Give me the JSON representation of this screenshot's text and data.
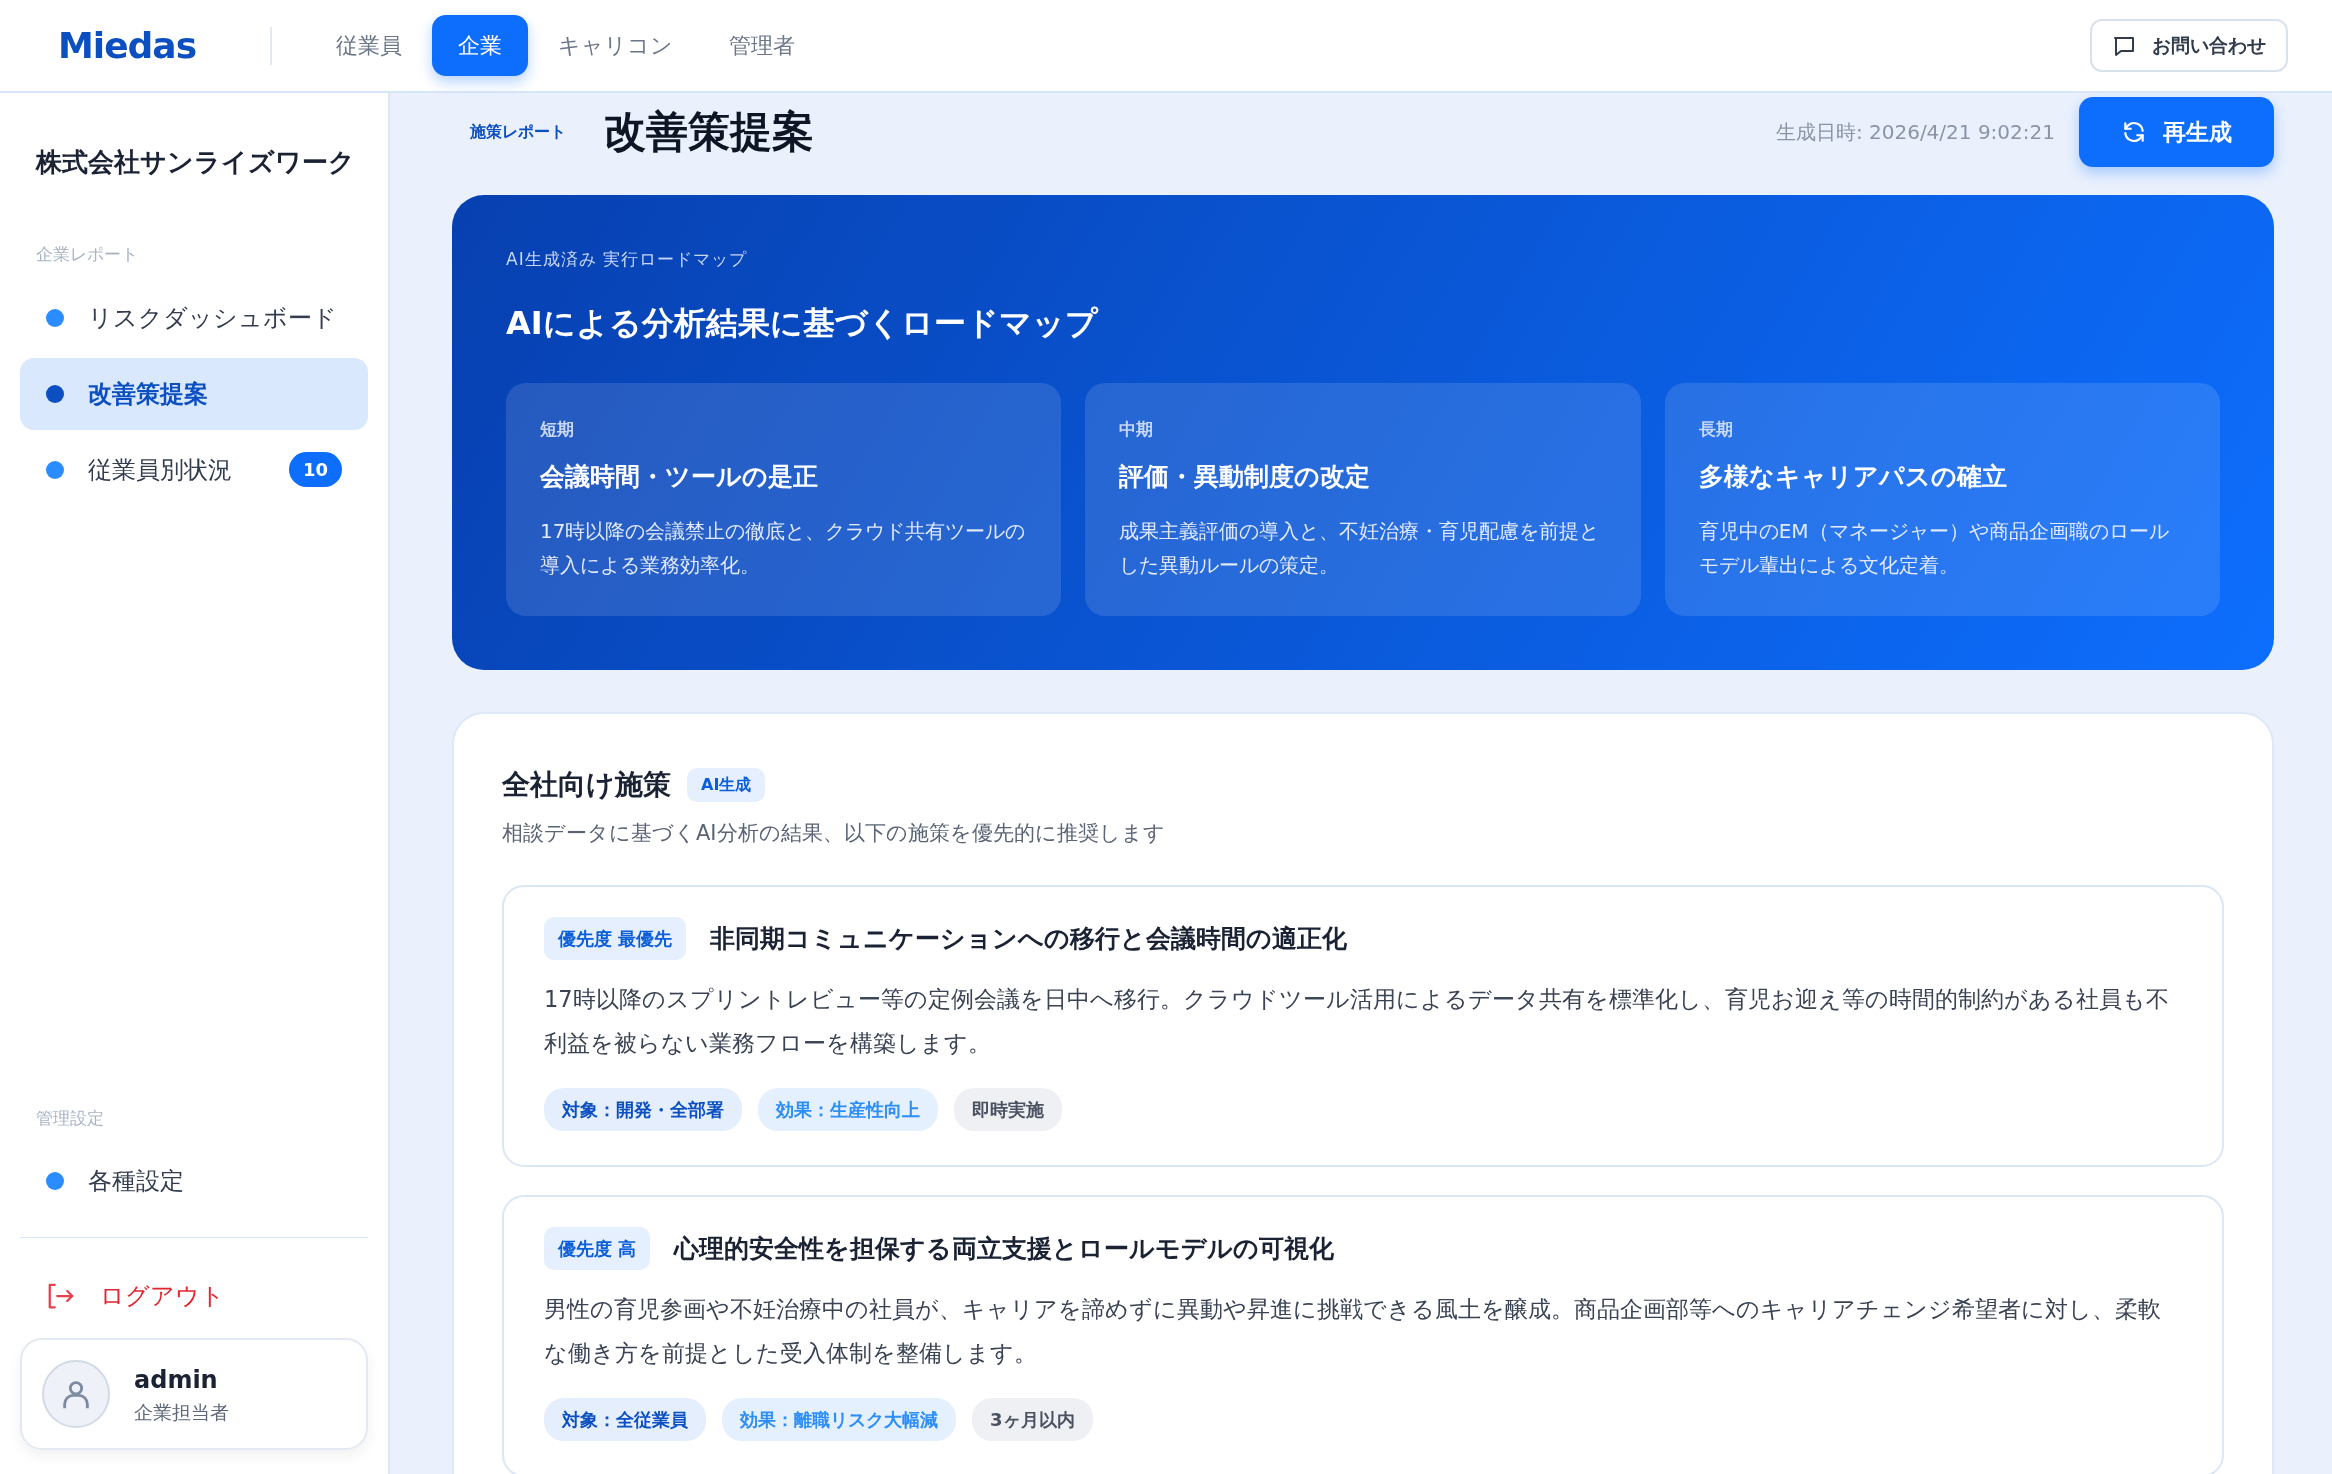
{
  "header": {
    "logo": "Miedas",
    "tabs": [
      {
        "label": "従業員",
        "selected": false
      },
      {
        "label": "企業",
        "selected": true
      },
      {
        "label": "キャリコン",
        "selected": false
      },
      {
        "label": "管理者",
        "selected": false
      }
    ],
    "contact_button": "お問い合わせ"
  },
  "sidebar": {
    "company": "株式会社サンライズワーク",
    "sections": [
      {
        "title": "企業レポート",
        "items": [
          {
            "label": "リスクダッシュボード",
            "selected": false
          },
          {
            "label": "改善策提案",
            "selected": true
          },
          {
            "label": "従業員別状況",
            "selected": false,
            "badge": "10"
          }
        ]
      },
      {
        "title": "管理設定",
        "items": [
          {
            "label": "各種設定",
            "selected": false
          }
        ]
      }
    ],
    "logout": "ログアウト",
    "user": {
      "name": "admin",
      "role": "企業担当者"
    }
  },
  "page": {
    "tag": "施策レポート",
    "title": "改善策提案",
    "generated": "生成日時: 2026/4/21 9:02:21",
    "regenerate_button": "再生成"
  },
  "roadmap": {
    "eyebrow": "AI生成済み 実行ロードマップ",
    "title": "AIによる分析結果に基づくロードマップ",
    "phases": [
      {
        "term": "短期",
        "title": "会議時間・ツールの是正",
        "text": "17時以降の会議禁止の徹底と、クラウド共有ツールの導入による業務効率化。"
      },
      {
        "term": "中期",
        "title": "評価・異動制度の改定",
        "text": "成果主義評価の導入と、不妊治療・育児配慮を前提とした異動ルールの策定。"
      },
      {
        "term": "長期",
        "title": "多様なキャリアパスの確立",
        "text": "育児中のEM（マネージャー）や商品企画職のロールモデル輩出による文化定着。"
      }
    ]
  },
  "measures": {
    "title": "全社向け施策",
    "badge": "AI生成",
    "subtitle": "相談データに基づくAI分析の結果、以下の施策を優先的に推奨します",
    "items": [
      {
        "priority": "優先度 最優先",
        "title": "非同期コミュニケーションへの移行と会議時間の適正化",
        "text": "17時以降のスプリントレビュー等の定例会議を日中へ移行。クラウドツール活用によるデータ共有を標準化し、育児お迎え等の時間的制約がある社員も不利益を被らない業務フローを構築します。",
        "tags": [
          {
            "kind": "target",
            "label": "対象：開発・全部署"
          },
          {
            "kind": "effect",
            "label": "効果：生産性向上"
          },
          {
            "kind": "timing",
            "label": "即時実施"
          }
        ]
      },
      {
        "priority": "優先度 高",
        "title": "心理的安全性を担保する両立支援とロールモデルの可視化",
        "text": "男性の育児参画や不妊治療中の社員が、キャリアを諦めずに異動や昇進に挑戦できる風土を醸成。商品企画部等へのキャリアチェンジ希望者に対し、柔軟な働き方を前提とした受入体制を整備します。",
        "tags": [
          {
            "kind": "target",
            "label": "対象：全従業員"
          },
          {
            "kind": "effect",
            "label": "効果：離職リスク大幅減"
          },
          {
            "kind": "timing",
            "label": "3ヶ月以内"
          }
        ]
      }
    ]
  }
}
